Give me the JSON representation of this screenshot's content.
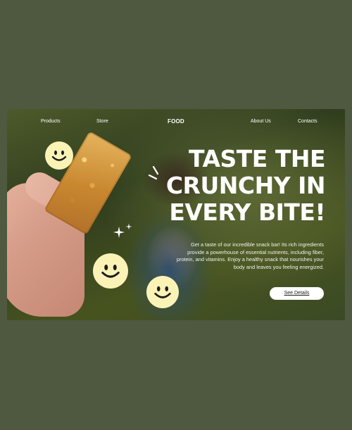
{
  "nav": {
    "products": "Products",
    "store": "Store",
    "brand": "FOOD",
    "about": "About Us",
    "contacts": "Contacts"
  },
  "hero": {
    "headline_line1": "TASTE THE",
    "headline_line2": "CRUNCHY IN",
    "headline_line3": "EVERY BITE!",
    "description": "Get a taste of our incredible snack bar! Its rich ingredients provide a powerhouse of essential nutrients, including fiber, protein, and vitamins. Enjoy a healthy snack that nourishes your body and leaves you feeling energized.",
    "cta_label": "See Details"
  },
  "icons": {
    "smiley": "smiley-face-icon",
    "sparkle": "sparkle-icon"
  },
  "colors": {
    "background": "#4f5940",
    "smiley": "#fbf3b6",
    "text": "#ffffff"
  }
}
